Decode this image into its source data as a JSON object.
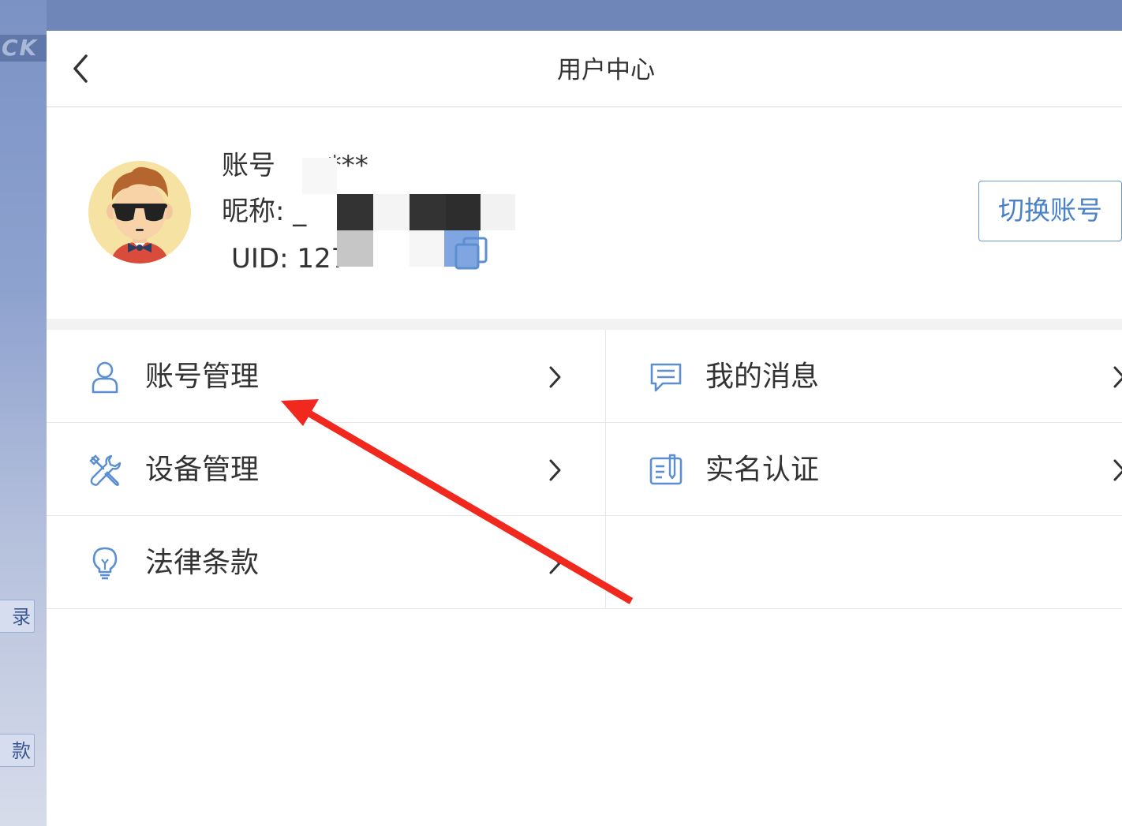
{
  "background": {
    "logo_text": "CK",
    "side_button_1": "录",
    "side_button_2": "款"
  },
  "header": {
    "title": "用户中心",
    "back_icon": "chevron-left-icon"
  },
  "profile": {
    "account_label": "账号",
    "account_value": "o***",
    "nickname_label": "昵称:",
    "nickname_value": "_",
    "uid_label": "UID:",
    "uid_value": "127",
    "switch_account_label": "切换账号",
    "avatar_icon": "cartoon-avatar-sunglasses",
    "copy_icon": "copy-icon"
  },
  "menu": {
    "items": [
      {
        "label": "账号管理",
        "icon": "user-icon"
      },
      {
        "label": "我的消息",
        "icon": "message-icon"
      },
      {
        "label": "设备管理",
        "icon": "tools-icon"
      },
      {
        "label": "实名认证",
        "icon": "id-card-icon"
      },
      {
        "label": "法律条款",
        "icon": "lightbulb-icon"
      }
    ]
  },
  "colors": {
    "accent": "#4a82c8",
    "icon_blue": "#5b8fd0",
    "annotation_red": "#f0281e",
    "background_top": "#6e86b8"
  }
}
